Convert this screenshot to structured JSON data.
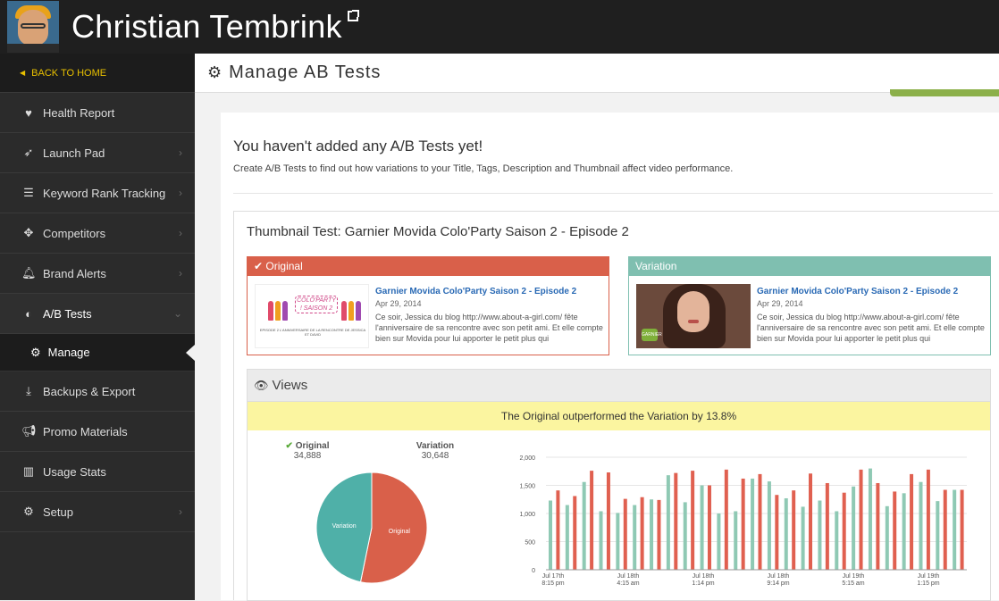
{
  "header": {
    "title": "Christian Tembrink"
  },
  "sidebar": {
    "back_label": "BACK TO HOME",
    "items": [
      {
        "label": "Health Report",
        "icon": "heartbeat-icon"
      },
      {
        "label": "Launch Pad",
        "icon": "rocket-icon"
      },
      {
        "label": "Keyword Rank Tracking",
        "icon": "list-icon"
      },
      {
        "label": "Competitors",
        "icon": "crosshair-icon"
      },
      {
        "label": "Brand Alerts",
        "icon": "bell-icon"
      },
      {
        "label": "A/B Tests",
        "icon": "half-circle-icon"
      },
      {
        "label": "Manage",
        "icon": "gear-icon"
      },
      {
        "label": "Backups & Export",
        "icon": "download-icon"
      },
      {
        "label": "Promo Materials",
        "icon": "megaphone-icon"
      },
      {
        "label": "Usage Stats",
        "icon": "bar-chart-icon"
      },
      {
        "label": "Setup",
        "icon": "gears-icon"
      }
    ]
  },
  "page": {
    "title": "Manage AB Tests"
  },
  "empty": {
    "title": "You haven't added any A/B Tests yet!",
    "desc": "Create A/B Tests to find out how variations to your Title, Tags, Description and Thumbnail affect video performance."
  },
  "test": {
    "title": "Thumbnail Test: Garnier Movida Colo'Party Saison 2 - Episode 2",
    "original": {
      "label": "Original",
      "video_title": "Garnier Movida Colo'Party Saison 2 - Episode 2",
      "date": "Apr 29, 2014",
      "desc": "Ce soir, Jessica du blog http://www.about-a-girl.com/ fête l'anniversaire de sa rencontre avec son petit ami. Et elle compte bien sur Movida pour lui apporter le petit plus qui",
      "thumb_logo": "COLO'PARTY ! SAISON 2",
      "thumb_caption": "EPISODE 2 L'ANNIVERSAIRE DE LA RENCONTRE DE JESSICA ET DAVID"
    },
    "variation": {
      "label": "Variation",
      "video_title": "Garnier Movida Colo'Party Saison 2 - Episode 2",
      "date": "Apr 29, 2014",
      "desc": "Ce soir, Jessica du blog http://www.about-a-girl.com/ fête l'anniversaire de sa rencontre avec son petit ami. Et elle compte bien sur Movida pour lui apporter le petit plus qui",
      "thumb_badge": "GARNIER"
    }
  },
  "views": {
    "title": "Views",
    "banner": "The Original outperformed the Variation by 13.8%",
    "legend": {
      "original_label": "Original",
      "original_value": "34,888",
      "variation_label": "Variation",
      "variation_value": "30,648"
    }
  },
  "colors": {
    "original": "#d9604a",
    "variation": "#7fbfb0",
    "pie_variation": "#4fb0a8"
  },
  "chart_data": [
    {
      "type": "pie",
      "categories": [
        "Original",
        "Variation"
      ],
      "values": [
        34888,
        30648
      ]
    },
    {
      "type": "bar",
      "ylim": [
        0,
        2000
      ],
      "yticks": [
        "0",
        "500",
        "1,000",
        "1,500",
        "2,000"
      ],
      "xtick_labels": [
        [
          "Jul 17th",
          "8:15 pm"
        ],
        [
          "Jul 18th",
          "4:15 am"
        ],
        [
          "Jul 18th",
          "1:14 pm"
        ],
        [
          "Jul 18th",
          "9:14 pm"
        ],
        [
          "Jul 19th",
          "5:15 am"
        ],
        [
          "Jul 19th",
          "1:15 pm"
        ]
      ],
      "series": [
        {
          "name": "Variation",
          "color": "#8fc9b4",
          "values": [
            1230,
            1150,
            1560,
            1040,
            1010,
            1150,
            1250,
            1680,
            1200,
            1500,
            1000,
            1040,
            1620,
            1570,
            1270,
            1120,
            1230,
            1040,
            1480,
            1800,
            1130,
            1360,
            1560,
            1220,
            1420
          ]
        },
        {
          "name": "Original",
          "color": "#e06050",
          "values": [
            1410,
            1310,
            1760,
            1730,
            1260,
            1290,
            1240,
            1720,
            1760,
            1500,
            1780,
            1620,
            1700,
            1330,
            1410,
            1710,
            1540,
            1370,
            1780,
            1540,
            1390,
            1700,
            1780,
            1420,
            1420
          ]
        }
      ]
    }
  ]
}
